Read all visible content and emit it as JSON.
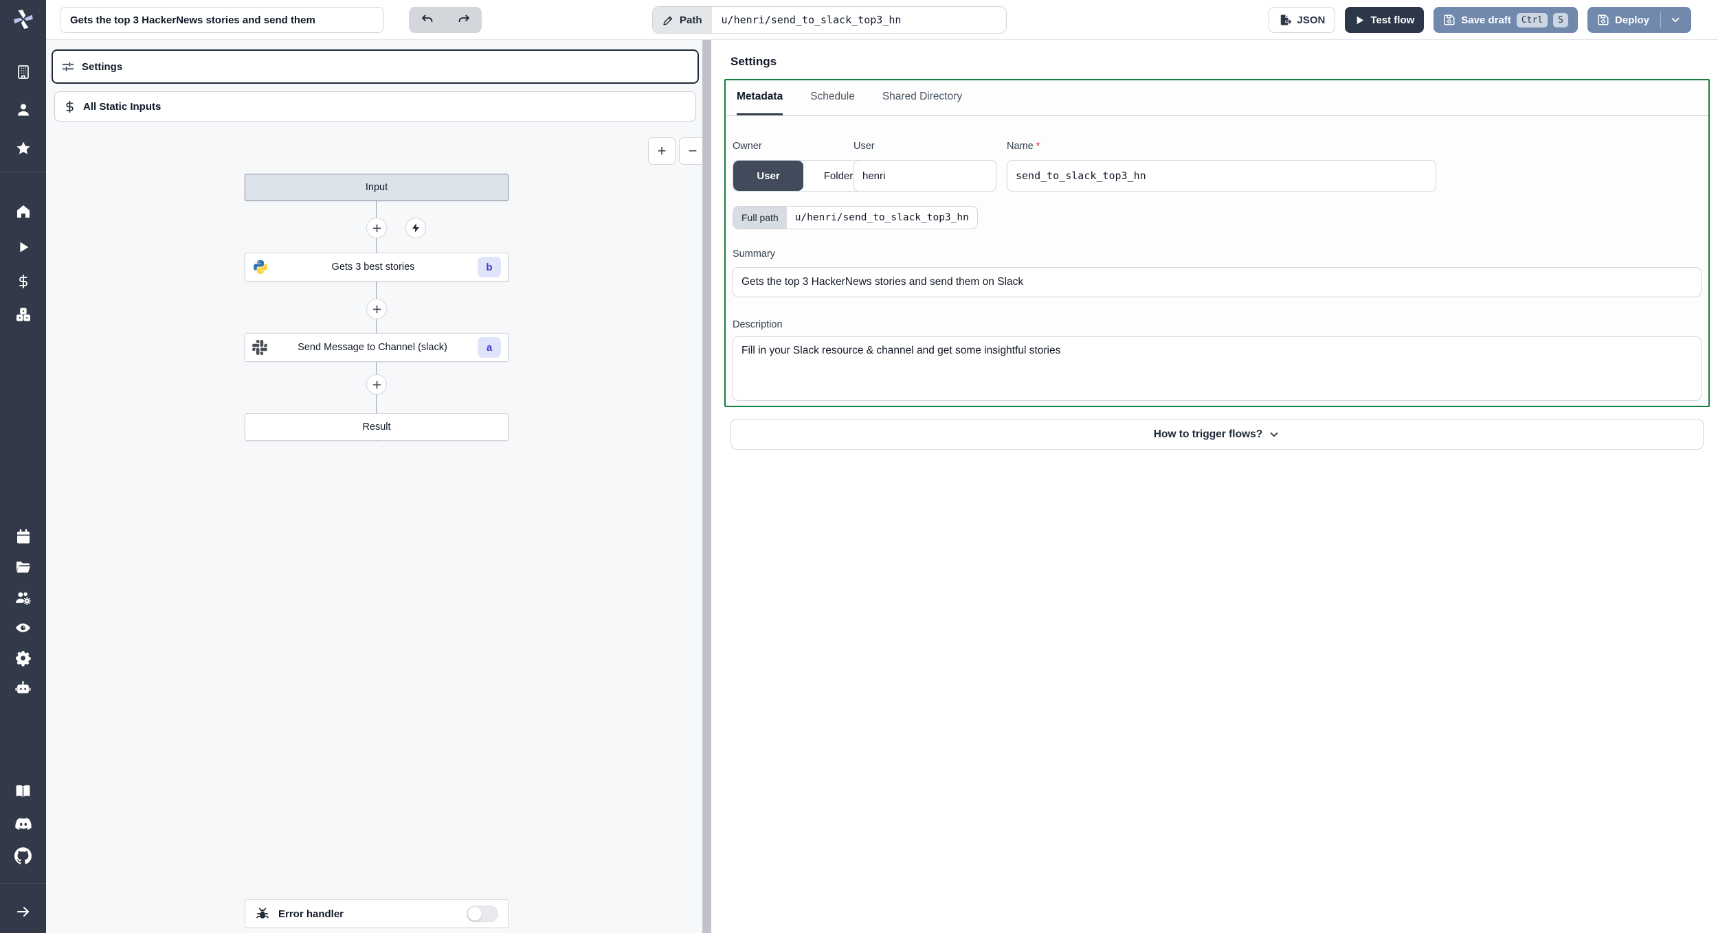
{
  "topbar": {
    "title_value": "Gets the top 3 HackerNews stories and send them",
    "path_label": "Path",
    "path_value": "u/henri/send_to_slack_top3_hn",
    "json_label": "JSON",
    "test_flow_label": "Test flow",
    "save_draft_label": "Save draft",
    "kbd_ctrl": "Ctrl",
    "kbd_s": "S",
    "deploy_label": "Deploy"
  },
  "left_panel": {
    "settings_label": "Settings",
    "static_inputs_label": "All Static Inputs",
    "zoom_in": "+",
    "zoom_out": "−"
  },
  "flow": {
    "input_label": "Input",
    "result_label": "Result",
    "steps": [
      {
        "label": "Gets 3 best stories",
        "badge": "b",
        "icon": "python-icon"
      },
      {
        "label": "Send Message to Channel (slack)",
        "badge": "a",
        "icon": "slack-icon"
      }
    ],
    "error_handler_label": "Error handler"
  },
  "settings_panel": {
    "title": "Settings",
    "tabs": [
      "Metadata",
      "Schedule",
      "Shared Directory"
    ],
    "active_tab": "Metadata",
    "owner": {
      "label": "Owner",
      "options": [
        "User",
        "Folder"
      ],
      "selected": "User"
    },
    "user_field": {
      "label": "User",
      "value": "henri"
    },
    "name_field": {
      "label": "Name",
      "required_mark": "*",
      "value": "send_to_slack_top3_hn"
    },
    "full_path": {
      "label": "Full path",
      "value": "u/henri/send_to_slack_top3_hn"
    },
    "summary": {
      "label": "Summary",
      "value": "Gets the top 3 HackerNews stories and send them on Slack"
    },
    "description": {
      "label": "Description",
      "value": "Fill in your Slack resource & channel and get some insightful stories"
    },
    "how_to_trigger_label": "How to trigger flows?"
  },
  "colors": {
    "sidebar_bg": "#323a49",
    "dark_navy_button": "#2c3849",
    "steel_blue_button": "#7089ad",
    "green_border": "#15803d",
    "badge_bg": "#e0e4fa",
    "badge_text": "#4338ca",
    "canvas_bg": "#f7f8fa"
  }
}
